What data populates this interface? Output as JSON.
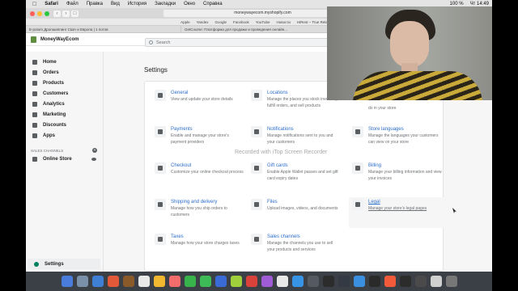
{
  "menubar": {
    "app": "Safari",
    "items": [
      "Файл",
      "Правка",
      "Вид",
      "История",
      "Закладки",
      "Окно",
      "Справка"
    ],
    "battery": "100 %",
    "clock": "Чт 14:49"
  },
  "browser": {
    "url": "moneywayecom.myshopify.com",
    "favorites": [
      "Apple",
      "Yandex",
      "Google",
      "Facebook",
      "YouTube",
      "Новости",
      "HiRest – True Relaxation"
    ],
    "tabs": [
      "E-potom Дропшиппинг США и Европа | 1 потов",
      "GetCourse: Платформа для продажи и проведения онлайн...",
      ""
    ]
  },
  "shopify": {
    "store_name": "MoneyWayEcom",
    "search_placeholder": "Search",
    "nav": {
      "home": "Home",
      "orders": "Orders",
      "products": "Products",
      "customers": "Customers",
      "analytics": "Analytics",
      "marketing": "Marketing",
      "discounts": "Discounts",
      "apps": "Apps",
      "sales_channels": "SALES CHANNELS",
      "online_store": "Online Store",
      "settings": "Settings"
    },
    "page_title": "Settings",
    "settings": [
      {
        "title": "General",
        "desc": "View and update your store details"
      },
      {
        "title": "Locations",
        "desc": "Manage the places you stock inventory, fulfill orders, and sell products"
      },
      {
        "title": "",
        "desc": "do in your store"
      },
      {
        "title": "Payments",
        "desc": "Enable and manage your store's payment providers"
      },
      {
        "title": "Notifications",
        "desc": "Manage notifications sent to you and your customers"
      },
      {
        "title": "Store languages",
        "desc": "Manage the languages your customers can view on your store"
      },
      {
        "title": "Checkout",
        "desc": "Customize your online checkout process"
      },
      {
        "title": "Gift cards",
        "desc": "Enable Apple Wallet passes and set gift card expiry dates"
      },
      {
        "title": "Billing",
        "desc": "Manage your billing information and view your invoices"
      },
      {
        "title": "Shipping and delivery",
        "desc": "Manage how you ship orders to customers"
      },
      {
        "title": "Files",
        "desc": "Upload images, videos, and documents"
      },
      {
        "title": "Legal",
        "desc": "Manage your store's legal pages"
      },
      {
        "title": "Taxes",
        "desc": "Manage how your store charges taxes"
      },
      {
        "title": "Sales channels",
        "desc": "Manage the channels you use to sell your products and services"
      }
    ]
  },
  "watermark": "Recorded with iTop Screen Recorder",
  "dock_colors": [
    "#4a7ddb",
    "#7a8fa8",
    "#3f7fd6",
    "#e05a3a",
    "#8b5a2b",
    "#e9e9e9",
    "#f0b830",
    "#f26c6c",
    "#38b24a",
    "#3dbb57",
    "#3a6ad6",
    "#9fcf3a",
    "#d9423b",
    "#a05cd6",
    "#e8e8e8",
    "#3794e5",
    "#555a62",
    "#2c2c2c",
    "#333a44",
    "#3b8fe0",
    "#2a2a2a",
    "#f25a3a",
    "#2c2c2c",
    "#4a4a4a",
    "#d0d0d0",
    "#777"
  ]
}
